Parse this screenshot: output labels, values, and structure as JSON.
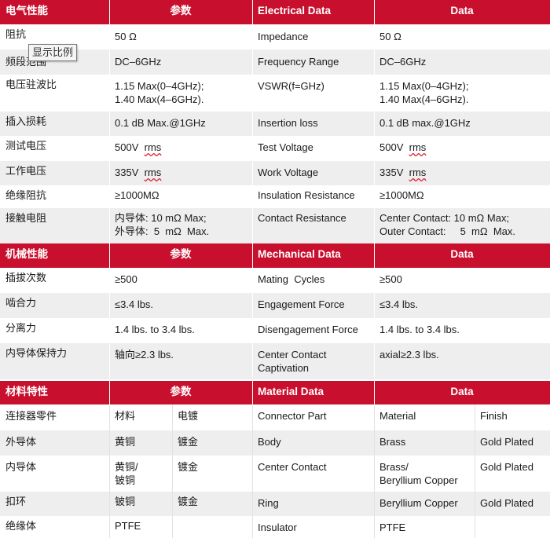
{
  "electrical": {
    "header": {
      "cn": "电气性能",
      "param": "参数",
      "en": "Electrical Data",
      "data": "Data"
    },
    "rows": [
      {
        "cn": "阻抗",
        "param": "50 Ω",
        "en": "Impedance",
        "data": "50 Ω"
      },
      {
        "cn": "频段范围",
        "param": "DC–6GHz",
        "en": "Frequency Range",
        "data": "DC–6GHz"
      },
      {
        "cn": "电压驻波比",
        "param": "1.15 Max(0–4GHz);",
        "param2": "1.40 Max(4–6GHz).",
        "en": "VSWR(f=GHz)",
        "data": "1.15 Max(0–4GHz);",
        "data2": "1.40 Max(4–6GHz)."
      },
      {
        "cn": "插入损耗",
        "param": "0.1 dB Max.@1GHz",
        "en": "Insertion loss",
        "data": "0.1 dB max.@1GHz"
      },
      {
        "cn": "测试电压",
        "param": "500V",
        "param_unit": "rms",
        "en": "Test Voltage",
        "data": "500V",
        "data_unit": "rms"
      },
      {
        "cn": "工作电压",
        "param": "335V",
        "param_unit": "rms",
        "en": "Work Voltage",
        "data": "335V",
        "data_unit": "rms"
      },
      {
        "cn": "绝缘阻抗",
        "param": "≥1000MΩ",
        "en": "Insulation Resistance",
        "data": "≥1000MΩ"
      },
      {
        "cn": "接触电阻",
        "param": "内导体: 10 mΩ  Max;",
        "param2": "外导体:  5  mΩ  Max.",
        "en": "Contact Resistance",
        "data": "Center Contact: 10 mΩ  Max;",
        "data2": "Outer Contact:     5  mΩ  Max."
      }
    ]
  },
  "mechanical": {
    "header": {
      "cn": "机械性能",
      "param": "参数",
      "en": "Mechanical Data",
      "data": "Data"
    },
    "rows": [
      {
        "cn": "插拔次数",
        "param": "≥500",
        "en": "Mating  Cycles",
        "data": "≥500"
      },
      {
        "cn": "啮合力",
        "param": "≤3.4 lbs.",
        "en": "Engagement Force",
        "data": "≤3.4 lbs."
      },
      {
        "cn": "分离力",
        "param": "1.4 lbs. to 3.4 lbs.",
        "en": "Disengagement Force",
        "data": "1.4 lbs. to 3.4 lbs."
      },
      {
        "cn": "内导体保持力",
        "param": "轴向≥2.3 lbs.",
        "en": "Center Contact",
        "en2": "Captivation",
        "data": "axial≥2.3 lbs."
      }
    ]
  },
  "material": {
    "header": {
      "cn": "材料特性",
      "param": "参数",
      "en": "Material Data",
      "data": "Data"
    },
    "rows": [
      {
        "cn": "连接器零件",
        "p1": "材料",
        "p2": "电镀",
        "en": "Connector Part",
        "d1": "Material",
        "d2": "Finish"
      },
      {
        "cn": "外导体",
        "p1": "黄铜",
        "p2": "镀金",
        "en": "Body",
        "d1": "Brass",
        "d2": "Gold Plated"
      },
      {
        "cn": "内导体",
        "p1": "黄铜/",
        "p1b": "铍铜",
        "p2": "镀金",
        "en": "Center Contact",
        "d1": "Brass/",
        "d1b": "Beryllium Copper",
        "d2": "Gold Plated"
      },
      {
        "cn": "扣环",
        "p1": "铍铜",
        "p2": "镀金",
        "en": "Ring",
        "d1": "Beryllium Copper",
        "d2": "Gold Plated"
      },
      {
        "cn": "绝缘体",
        "p1": "PTFE",
        "p2": "",
        "en": "Insulator",
        "d1": "PTFE",
        "d2": ""
      }
    ]
  },
  "tooltip": "显示比例"
}
